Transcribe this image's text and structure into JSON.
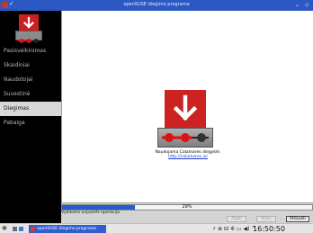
{
  "titlebar": {
    "title": "openSUSE diegimo programa",
    "check_glyph": "✓",
    "menu_glyph": "⌄",
    "close_glyph": "◇"
  },
  "sidebar": {
    "items": [
      {
        "label": "Pasisveikinimas"
      },
      {
        "label": "Skaidiniai"
      },
      {
        "label": "Naudotojai"
      },
      {
        "label": "Suvestinė"
      },
      {
        "label": "Diegimas"
      },
      {
        "label": "Pabaiga"
      }
    ]
  },
  "main": {
    "logo_caption": "Naudojama Calamares diegyklė.",
    "logo_link": "http://calamares.io/"
  },
  "progress": {
    "value": 0.29,
    "label": "29%"
  },
  "status": {
    "text": "Vykdoma unpackfs operacija."
  },
  "buttons": {
    "back": "Atgal",
    "next": "Kitas",
    "cancel": "Atšaukti"
  },
  "taskbar": {
    "start_glyph": "❃",
    "task_label": "openSUSE diegimo programa",
    "tray_text": "⚡ ⊕ ⊟ ✲ ▭ ◀) ^",
    "clock": "16:50:50"
  },
  "colors": {
    "titlebar": "#2b58c2",
    "accent_red": "#cc2222",
    "progress_fill": "#1f62c7",
    "sidebar_bg": "#000000"
  }
}
